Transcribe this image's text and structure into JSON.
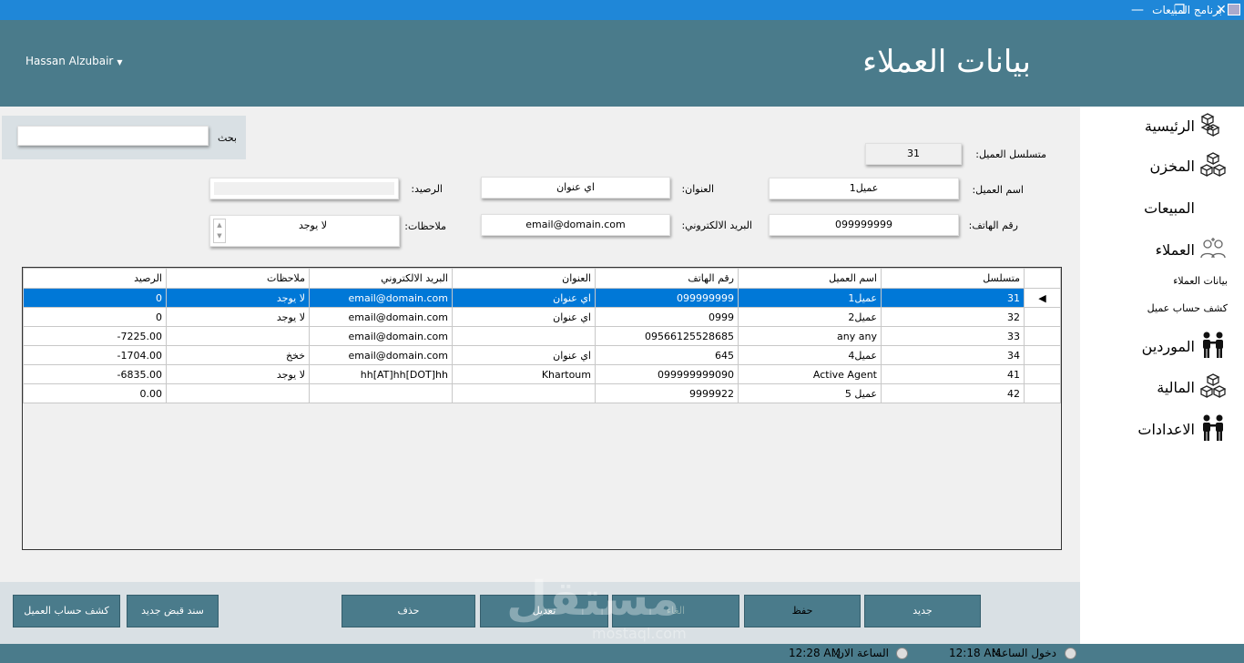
{
  "window": {
    "title": "برنامج المبيعات",
    "controls": [
      "—",
      "❐",
      "✕"
    ]
  },
  "header": {
    "user": "Hassan Alzubair",
    "page_title": "بيانات العملاء"
  },
  "sidebar": {
    "items": [
      {
        "label": "الرئيسية",
        "icon": "boxes-icon"
      },
      {
        "label": "المخزن",
        "icon": "boxes-icon"
      },
      {
        "label": "المبيعات",
        "icon": ""
      },
      {
        "label": "العملاء",
        "icon": "users-icon"
      },
      {
        "label": "الموردين",
        "icon": "people-icon"
      },
      {
        "label": "المالية",
        "icon": "boxes-icon"
      },
      {
        "label": "الاعدادات",
        "icon": "people-icon"
      }
    ],
    "sub_items": [
      "بيانات العملاء",
      "كشف حساب عميل"
    ]
  },
  "search": {
    "label": "بحث",
    "value": ""
  },
  "form": {
    "serial_label": "متسلسل العميل:",
    "serial_value": "31",
    "name_label": "اسم العميل:",
    "name_value": "عميل1",
    "address_label": "العنوان:",
    "address_value": "اي عنوان",
    "balance_label": "الرصيد:",
    "balance_value": "",
    "phone_label": "رقم الهاتف:",
    "phone_value": "099999999",
    "email_label": "البريد الالكتروني:",
    "email_value": "email@domain.com",
    "notes_label": "ملاحظات:",
    "notes_value": "لا يوجد"
  },
  "grid": {
    "columns": [
      "متسلسل",
      "اسم العميل",
      "رقم الهاتف",
      "العنوان",
      "البريد الالكتروني",
      "ملاحظات",
      "الرصيد"
    ],
    "rows": [
      [
        "31",
        "عميل1",
        "099999999",
        "اي عنوان",
        "email@domain.com",
        "لا يوجد",
        "0"
      ],
      [
        "32",
        "عميل2",
        "0999",
        "اي عنوان",
        "email@domain.com",
        "لا يوجد",
        "0"
      ],
      [
        "33",
        "any any",
        "09566125528685",
        "",
        "email@domain.com",
        "",
        "-7225.00"
      ],
      [
        "34",
        "عميل4",
        "645",
        "اي عنوان",
        "email@domain.com",
        "خخخ",
        "-1704.00"
      ],
      [
        "41",
        "Active Agent",
        "099999999090",
        "Khartoum",
        "hh[AT]hh[DOT]hh",
        "لا يوجد",
        "-6835.00"
      ],
      [
        "42",
        "عميل 5",
        "9999922",
        "",
        "",
        "",
        "0.00"
      ]
    ],
    "selected_row": 0
  },
  "buttons": {
    "new": "جديد",
    "save": "حفظ",
    "cancel": "الغاء",
    "edit": "تعديل",
    "delete": "حذف",
    "receipt": "سند قبض جديد",
    "statement": "كشف حساب العميل"
  },
  "status": {
    "login_label": "دخول الساعة:",
    "login_time": "12:18 AM",
    "now_label": "الساعة الان:",
    "now_time": "12:28 AM"
  },
  "watermark": {
    "text": "مستقل",
    "sub": "mostaql.com"
  },
  "colors": {
    "header": "#4a7b8b",
    "titlebar": "#1f87d8",
    "selection": "#0078d7"
  }
}
